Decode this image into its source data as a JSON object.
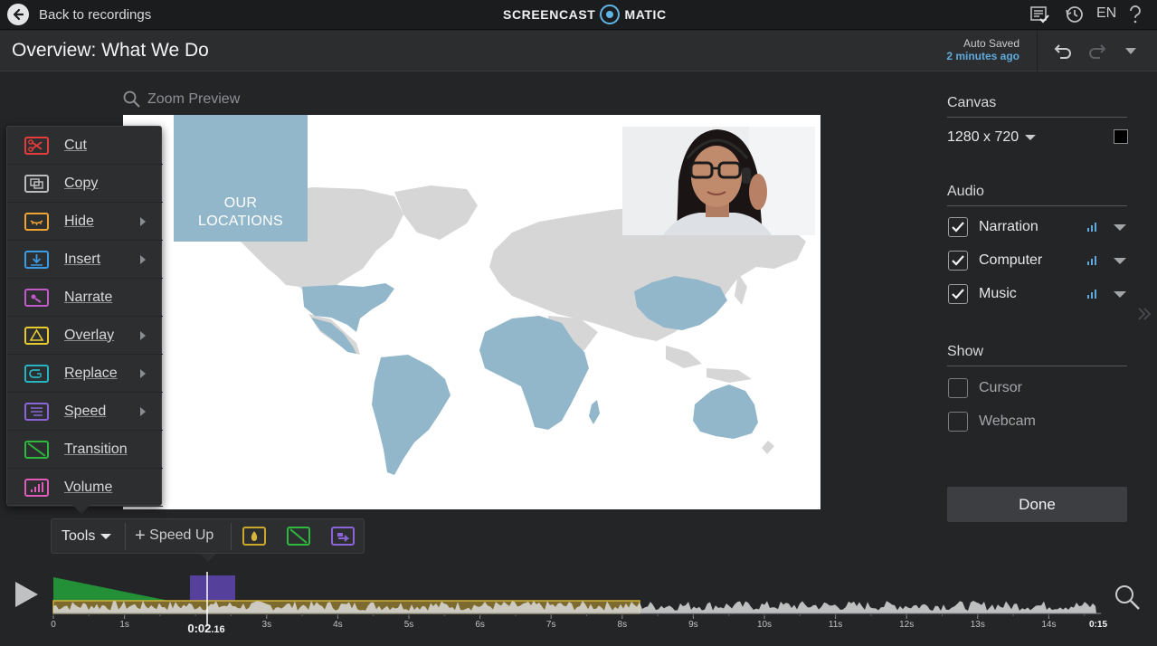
{
  "header": {
    "back_label": "Back to recordings",
    "logo_left": "SCREENCAST",
    "logo_right": "MATIC",
    "language": "EN"
  },
  "title_bar": {
    "title": "Overview: What We Do",
    "autosave_label": "Auto Saved",
    "autosave_time": "2 minutes ago"
  },
  "preview": {
    "zoom_label": "Zoom Preview",
    "overlay_text_line1": "OUR",
    "overlay_text_line2": "LOCATIONS"
  },
  "tools_menu": {
    "items": [
      {
        "label": "Cut",
        "icon": "scissors-icon",
        "color": "#e53b3b",
        "submenu": false
      },
      {
        "label": "Copy",
        "icon": "copy-icon",
        "color": "#b9bbbd",
        "submenu": false
      },
      {
        "label": "Hide",
        "icon": "hide-icon",
        "color": "#f0a330",
        "submenu": true
      },
      {
        "label": "Insert",
        "icon": "insert-icon",
        "color": "#3a9be6",
        "submenu": true
      },
      {
        "label": "Narrate",
        "icon": "narrate-icon",
        "color": "#c25ac9",
        "submenu": false
      },
      {
        "label": "Overlay",
        "icon": "overlay-icon",
        "color": "#e6cb2d",
        "submenu": true
      },
      {
        "label": "Replace",
        "icon": "replace-icon",
        "color": "#25b5c2",
        "submenu": true
      },
      {
        "label": "Speed",
        "icon": "speed-icon",
        "color": "#8a65d9",
        "submenu": true
      },
      {
        "label": "Transition",
        "icon": "transition-icon",
        "color": "#2db93d",
        "submenu": false
      },
      {
        "label": "Volume",
        "icon": "volume-icon",
        "color": "#e05bb9",
        "submenu": false
      }
    ]
  },
  "toolbar": {
    "tools_label": "Tools",
    "speedup_label": "Speed Up"
  },
  "right_panel": {
    "canvas_title": "Canvas",
    "canvas_size": "1280 x 720",
    "audio_title": "Audio",
    "audio": [
      {
        "label": "Narration",
        "checked": true
      },
      {
        "label": "Computer",
        "checked": true
      },
      {
        "label": "Music",
        "checked": true
      }
    ],
    "show_title": "Show",
    "show": [
      {
        "label": "Cursor",
        "checked": false
      },
      {
        "label": "Webcam",
        "checked": false
      }
    ],
    "done_label": "Done"
  },
  "timeline": {
    "current_time": "0:02",
    "current_time_fraction": ".16",
    "end_label": "0:15",
    "tick_labels": [
      "0",
      "1s",
      "3s",
      "4s",
      "5s",
      "6s",
      "7s",
      "8s",
      "9s",
      "10s",
      "11s",
      "12s",
      "13s",
      "14s"
    ]
  },
  "colors": {
    "accent_blue": "#5fa9dc",
    "map_highlight": "#92b7cb",
    "map_base": "#d6d6d6"
  }
}
